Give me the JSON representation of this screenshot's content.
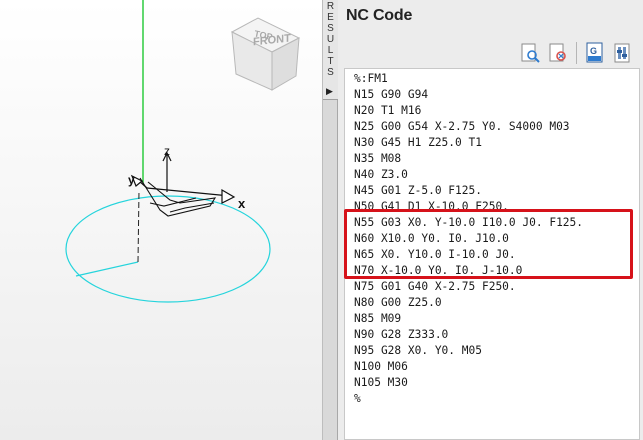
{
  "viewcube": {
    "top_label": "TOP",
    "front_label": "FRONT"
  },
  "axes": {
    "x_label": "x",
    "y_label": "y",
    "z_label": "z"
  },
  "results_tab": {
    "label": "RESULTS"
  },
  "nc_panel": {
    "title": "NC Code",
    "toolbar_icons": [
      "find-icon",
      "replace-icon",
      "g-code-icon",
      "settings-icon"
    ],
    "lines": [
      "%:FM1",
      "N15 G90 G94",
      "N20 T1 M16",
      "N25 G00 G54 X-2.75 Y0. S4000 M03",
      "N30 G45 H1 Z25.0 T1",
      "N35 M08",
      "N40 Z3.0",
      "N45 G01 Z-5.0 F125.",
      "N50 G41 D1 X-10.0 F250.",
      "N55 G03 X0. Y-10.0 I10.0 J0. F125.",
      "N60 X10.0 Y0. I0. J10.0",
      "N65 X0. Y10.0 I-10.0 J0.",
      "N70 X-10.0 Y0. I0. J-10.0",
      "N75 G01 G40 X-2.75 F250.",
      "N80 G00 Z25.0",
      "N85 M09",
      "N90 G28 Z333.0",
      "N95 G28 X0. Y0. M05",
      "N100 M06",
      "N105 M30",
      "%"
    ],
    "highlight_color": "#d6121a"
  }
}
